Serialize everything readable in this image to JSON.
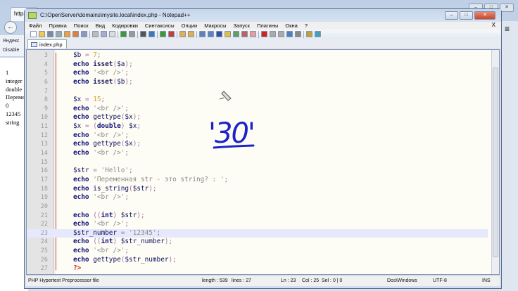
{
  "browser": {
    "tab_label": "https",
    "bookmarks": [
      "Яндекс",
      "Disable"
    ],
    "output_lines": [
      "1",
      "integer",
      "double",
      "Переменная str - это string? :",
      "0",
      "12345",
      "string"
    ]
  },
  "window": {
    "title": "C:\\OpenServer\\domains\\mysite.local\\index.php - Notepad++",
    "minimize": "–",
    "maximize": "□",
    "close": "✕"
  },
  "menu": [
    "Файл",
    "Правка",
    "Поиск",
    "Вид",
    "Кодировки",
    "Синтаксисы",
    "Опции",
    "Макросы",
    "Запуск",
    "Плагины",
    "Окна",
    "?"
  ],
  "menu_close": "X",
  "tab": {
    "label": "index.php"
  },
  "editor": {
    "current_line": 23,
    "lines": [
      {
        "n": "3",
        "t": [
          [
            "var",
            "$b"
          ],
          [
            "op",
            " = "
          ],
          [
            "num2",
            "7"
          ],
          [
            "op",
            ";"
          ]
        ]
      },
      {
        "n": "4",
        "t": [
          [
            "kw",
            "echo "
          ],
          [
            "fn",
            "isset"
          ],
          [
            "op",
            "("
          ],
          [
            "var",
            "$a"
          ],
          [
            "op",
            ");"
          ]
        ]
      },
      {
        "n": "5",
        "t": [
          [
            "kw",
            "echo "
          ],
          [
            "str",
            "'<br />'"
          ],
          [
            "op",
            ";"
          ]
        ]
      },
      {
        "n": "6",
        "t": [
          [
            "kw",
            "echo "
          ],
          [
            "fn",
            "isset"
          ],
          [
            "op",
            "("
          ],
          [
            "var",
            "$b"
          ],
          [
            "op",
            ");"
          ]
        ]
      },
      {
        "n": "7",
        "t": []
      },
      {
        "n": "8",
        "t": [
          [
            "var",
            "$x"
          ],
          [
            "op",
            " = "
          ],
          [
            "num2",
            "15"
          ],
          [
            "op",
            ";"
          ]
        ]
      },
      {
        "n": "9",
        "t": [
          [
            "kw",
            "echo "
          ],
          [
            "str",
            "'<br />'"
          ],
          [
            "op",
            ";"
          ]
        ]
      },
      {
        "n": "10",
        "t": [
          [
            "kw",
            "echo "
          ],
          [
            "var",
            "gettype"
          ],
          [
            "op",
            "("
          ],
          [
            "var",
            "$x"
          ],
          [
            "op",
            ");"
          ]
        ]
      },
      {
        "n": "11",
        "t": [
          [
            "var",
            "$x"
          ],
          [
            "op",
            " = "
          ],
          [
            "op",
            "("
          ],
          [
            "cast",
            "double"
          ],
          [
            "op",
            ") "
          ],
          [
            "var",
            "$x"
          ],
          [
            "op",
            ";"
          ]
        ]
      },
      {
        "n": "12",
        "t": [
          [
            "kw",
            "echo "
          ],
          [
            "str",
            "'<br />'"
          ],
          [
            "op",
            ";"
          ]
        ]
      },
      {
        "n": "13",
        "t": [
          [
            "kw",
            "echo "
          ],
          [
            "var",
            "gettype"
          ],
          [
            "op",
            "("
          ],
          [
            "var",
            "$x"
          ],
          [
            "op",
            ");"
          ]
        ]
      },
      {
        "n": "14",
        "t": [
          [
            "kw",
            "echo "
          ],
          [
            "str",
            "'<br />'"
          ],
          [
            "op",
            ";"
          ]
        ]
      },
      {
        "n": "15",
        "t": []
      },
      {
        "n": "16",
        "t": [
          [
            "var",
            "$str"
          ],
          [
            "op",
            " = "
          ],
          [
            "str",
            "'Hello'"
          ],
          [
            "op",
            ";"
          ]
        ]
      },
      {
        "n": "17",
        "t": [
          [
            "kw",
            "echo "
          ],
          [
            "str",
            "'Переменная str - это string? : '"
          ],
          [
            "op",
            ";"
          ]
        ]
      },
      {
        "n": "18",
        "t": [
          [
            "kw",
            "echo "
          ],
          [
            "var",
            "is_string"
          ],
          [
            "op",
            "("
          ],
          [
            "var",
            "$str"
          ],
          [
            "op",
            ");"
          ]
        ]
      },
      {
        "n": "19",
        "t": [
          [
            "kw",
            "echo "
          ],
          [
            "str",
            "'<br />'"
          ],
          [
            "op",
            ";"
          ]
        ]
      },
      {
        "n": "20",
        "t": []
      },
      {
        "n": "21",
        "t": [
          [
            "kw",
            "echo "
          ],
          [
            "op",
            "(("
          ],
          [
            "cast",
            "int"
          ],
          [
            "op",
            ") "
          ],
          [
            "var",
            "$str"
          ],
          [
            "op",
            ");"
          ]
        ]
      },
      {
        "n": "22",
        "t": [
          [
            "kw",
            "echo "
          ],
          [
            "str",
            "'<br />'"
          ],
          [
            "op",
            ";"
          ]
        ]
      },
      {
        "n": "23",
        "t": [
          [
            "var",
            "$str_number"
          ],
          [
            "op",
            " = "
          ],
          [
            "str",
            "'12345'"
          ],
          [
            "op",
            ";"
          ]
        ]
      },
      {
        "n": "24",
        "t": [
          [
            "kw",
            "echo "
          ],
          [
            "op",
            "(("
          ],
          [
            "cast",
            "int"
          ],
          [
            "op",
            ") "
          ],
          [
            "var",
            "$str_number"
          ],
          [
            "op",
            ");"
          ]
        ]
      },
      {
        "n": "25",
        "t": [
          [
            "kw",
            "echo "
          ],
          [
            "str",
            "'<br />'"
          ],
          [
            "op",
            ";"
          ]
        ]
      },
      {
        "n": "26",
        "t": [
          [
            "kw",
            "echo "
          ],
          [
            "var",
            "gettype"
          ],
          [
            "op",
            "("
          ],
          [
            "var",
            "$str_number"
          ],
          [
            "op",
            ");"
          ]
        ]
      },
      {
        "n": "27",
        "t": [
          [
            "php",
            "?>"
          ]
        ]
      }
    ]
  },
  "annotation": {
    "text": "'30'",
    "color": "#1a22c8"
  },
  "status": {
    "file_type": "PHP Hypertext Preprocessor file",
    "length": "length : 539",
    "lines": "lines : 27",
    "ln": "Ln : 23",
    "col": "Col : 25",
    "sel": "Sel : 0 | 0",
    "eol": "Dos\\Windows",
    "encoding": "UTF-8",
    "mode": "INS"
  }
}
